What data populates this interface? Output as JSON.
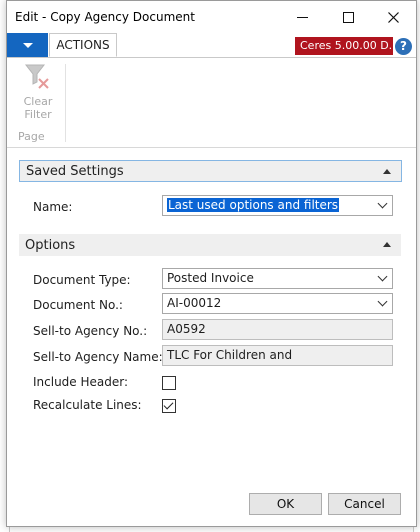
{
  "window": {
    "title": "Edit - Copy Agency Document"
  },
  "ribbon": {
    "tab_actions": "ACTIONS",
    "brand": "Ceres 5.00.00 D...",
    "help_glyph": "?",
    "clear_filter_lines": [
      "Clear",
      "Filter"
    ],
    "group_label": "Page"
  },
  "saved_settings": {
    "header": "Saved Settings",
    "name_label": "Name:",
    "name_value": "Last used options and filters"
  },
  "options": {
    "header": "Options",
    "document_type_label": "Document Type:",
    "document_type_value": "Posted Invoice",
    "document_no_label": "Document No.:",
    "document_no_value": "AI-00012",
    "sell_to_no_label": "Sell-to Agency No.:",
    "sell_to_no_value": "A0592",
    "sell_to_name_label": "Sell-to Agency Name:",
    "sell_to_name_value": "TLC For Children and",
    "include_header_label": "Include Header:",
    "include_header_checked": false,
    "recalculate_lines_label": "Recalculate Lines:",
    "recalculate_lines_checked": true
  },
  "buttons": {
    "ok": "OK",
    "cancel": "Cancel"
  },
  "colors": {
    "accent_blue": "#1466c0",
    "brand_red": "#b0141e",
    "selection_blue": "#0a64d4"
  }
}
